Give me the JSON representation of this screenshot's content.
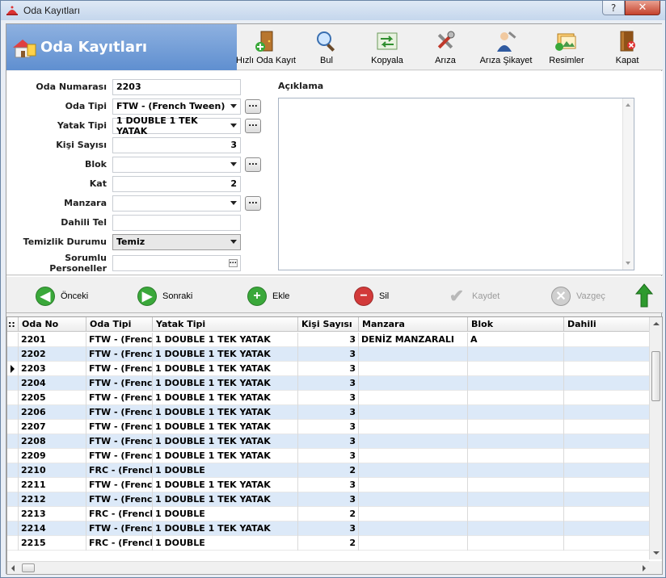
{
  "window": {
    "title": "Oda Kayıtları"
  },
  "header": {
    "title": "Oda Kayıtları"
  },
  "toolbar": [
    {
      "label": "Hızlı Oda Kayıt",
      "icon": "door-add-icon"
    },
    {
      "label": "Bul",
      "icon": "magnifier-icon"
    },
    {
      "label": "Kopyala",
      "icon": "copy-arrows-icon"
    },
    {
      "label": "Arıza",
      "icon": "tools-icon"
    },
    {
      "label": "Arıza Şikayet",
      "icon": "repairman-icon"
    },
    {
      "label": "Resimler",
      "icon": "pictures-icon"
    },
    {
      "label": "Kapat",
      "icon": "exit-door-icon"
    }
  ],
  "form": {
    "oda_numarasi": {
      "label": "Oda Numarası",
      "value": "2203"
    },
    "oda_tipi": {
      "label": "Oda Tipi",
      "value": "FTW - (French Tween)"
    },
    "yatak_tipi": {
      "label": "Yatak Tipi",
      "value": "1 DOUBLE 1 TEK YATAK"
    },
    "kisi_sayisi": {
      "label": "Kişi Sayısı",
      "value": "3"
    },
    "blok": {
      "label": "Blok",
      "value": ""
    },
    "kat": {
      "label": "Kat",
      "value": "2"
    },
    "manzara": {
      "label": "Manzara",
      "value": ""
    },
    "dahili_tel": {
      "label": "Dahili Tel",
      "value": ""
    },
    "temizlik_durumu": {
      "label": "Temizlik Durumu",
      "value": "Temiz"
    },
    "sorumlu_personeller": {
      "label": "Sorumlu Personeller",
      "value": ""
    },
    "ellipsis": "...",
    "aciklama_label": "Açıklama"
  },
  "nav": {
    "prev": "Önceki",
    "next": "Sonraki",
    "add": "Ekle",
    "delete": "Sil",
    "save": "Kaydet",
    "cancel": "Vazgeç"
  },
  "grid": {
    "indicator_header": "::",
    "columns": [
      "Oda No",
      "Oda Tipi",
      "Yatak Tipi",
      "Kişi Sayısı",
      "Manzara",
      "Blok",
      "Dahili"
    ],
    "selected_row": 2,
    "rows": [
      [
        "2201",
        "FTW - (French",
        "1 DOUBLE 1 TEK YATAK",
        "3",
        "DENİZ MANZARALI",
        "A",
        ""
      ],
      [
        "2202",
        "FTW - (French",
        "1 DOUBLE 1 TEK YATAK",
        "3",
        "",
        "",
        ""
      ],
      [
        "2203",
        "FTW - (French",
        "1 DOUBLE 1 TEK YATAK",
        "3",
        "",
        "",
        ""
      ],
      [
        "2204",
        "FTW - (French",
        "1 DOUBLE 1 TEK YATAK",
        "3",
        "",
        "",
        ""
      ],
      [
        "2205",
        "FTW - (French",
        "1 DOUBLE 1 TEK YATAK",
        "3",
        "",
        "",
        ""
      ],
      [
        "2206",
        "FTW - (French",
        "1 DOUBLE 1 TEK YATAK",
        "3",
        "",
        "",
        ""
      ],
      [
        "2207",
        "FTW - (French",
        "1 DOUBLE 1 TEK YATAK",
        "3",
        "",
        "",
        ""
      ],
      [
        "2208",
        "FTW - (French",
        "1 DOUBLE 1 TEK YATAK",
        "3",
        "",
        "",
        ""
      ],
      [
        "2209",
        "FTW - (French",
        "1 DOUBLE 1 TEK YATAK",
        "3",
        "",
        "",
        ""
      ],
      [
        "2210",
        "FRC - (French",
        "1 DOUBLE",
        "2",
        "",
        "",
        ""
      ],
      [
        "2211",
        "FTW - (French",
        "1 DOUBLE 1 TEK YATAK",
        "3",
        "",
        "",
        ""
      ],
      [
        "2212",
        "FTW - (French",
        "1 DOUBLE 1 TEK YATAK",
        "3",
        "",
        "",
        ""
      ],
      [
        "2213",
        "FRC - (French",
        "1 DOUBLE",
        "2",
        "",
        "",
        ""
      ],
      [
        "2214",
        "FTW - (French",
        "1 DOUBLE 1 TEK YATAK",
        "3",
        "",
        "",
        ""
      ],
      [
        "2215",
        "FRC - (French",
        "1 DOUBLE",
        "2",
        "",
        "",
        ""
      ]
    ]
  },
  "colors": {
    "header_blue": "#6f9ad6",
    "row_alt": "#dce9f8",
    "nav_green": "#3aa83a",
    "nav_red": "#d23a3a"
  }
}
